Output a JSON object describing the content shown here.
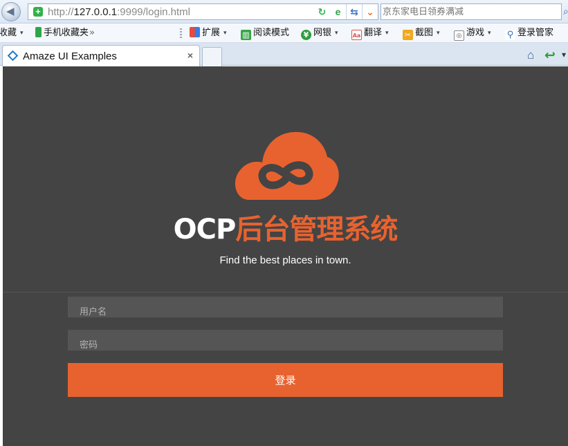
{
  "browser": {
    "url_scheme": "http://",
    "url_host": "127.0.0.1",
    "url_rest": ":9999/login.html",
    "search_placeholder": "京东家电日领券满减",
    "bookmarks": [
      {
        "label": "收藏",
        "caret": "▾"
      },
      {
        "label": "手机收藏夹",
        "suffix": "»"
      },
      {
        "label": "扩展",
        "caret": "▾"
      },
      {
        "label": "阅读模式"
      },
      {
        "label": "网银",
        "caret": "▾"
      },
      {
        "label": "翻译",
        "caret": "▾"
      },
      {
        "label": "截图",
        "caret": "▾"
      },
      {
        "label": "游戏",
        "caret": "▾"
      },
      {
        "label": "登录管家"
      }
    ],
    "tab_title": "Amaze UI Examples",
    "tab_close": "×",
    "icons": [
      "back-icon",
      "secure-icon",
      "refresh-icon",
      "ie-mode-icon",
      "switch-icon",
      "dropdown-icon",
      "home-icon",
      "reply-icon"
    ]
  },
  "page": {
    "title_latin": "OCP",
    "title_cjk": "后台管理系统",
    "subtitle": "Find the best places in town.",
    "username_placeholder": "用户名",
    "password_placeholder": "密码",
    "login_label": "登录",
    "colors": {
      "background": "#444444",
      "accent": "#e8622f",
      "input_bg": "#555555"
    }
  }
}
